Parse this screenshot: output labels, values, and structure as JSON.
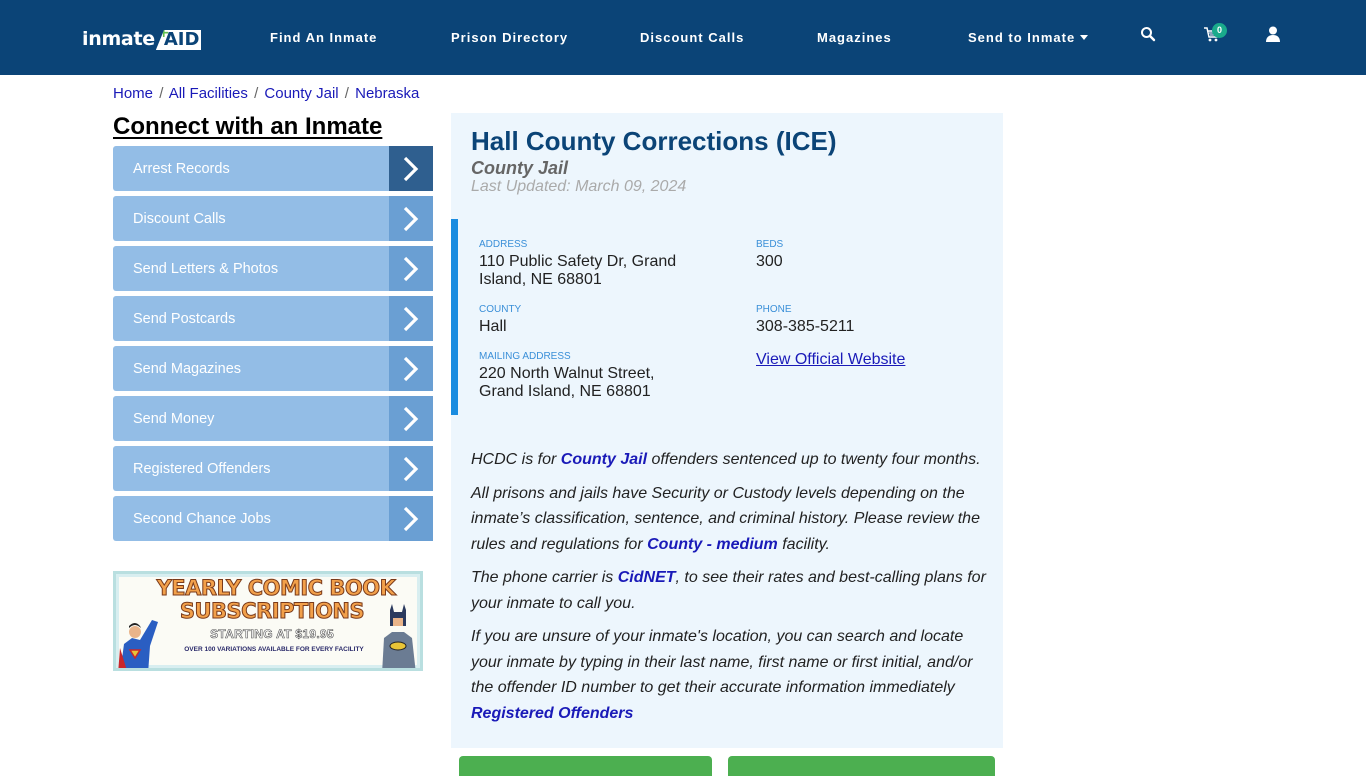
{
  "header": {
    "logo": {
      "part1": "inmate",
      "part2": "AID",
      "plus": "+"
    },
    "nav": [
      {
        "label": "Find An Inmate"
      },
      {
        "label": "Prison Directory"
      },
      {
        "label": "Discount Calls"
      },
      {
        "label": "Magazines"
      },
      {
        "label": "Send to Inmate",
        "dropdown": true
      }
    ],
    "icons": {
      "search": "search-icon",
      "cart": "cart-icon",
      "user": "user-icon"
    },
    "cart_count": "0"
  },
  "breadcrumb": [
    {
      "label": "Home"
    },
    {
      "label": "All Facilities"
    },
    {
      "label": "County Jail"
    },
    {
      "label": "Nebraska"
    }
  ],
  "breadcrumb_separator": "/",
  "sidebar": {
    "title": "Connect with an Inmate",
    "items": [
      {
        "label": "Arrest Records"
      },
      {
        "label": "Discount Calls"
      },
      {
        "label": "Send Letters & Photos"
      },
      {
        "label": "Send Postcards"
      },
      {
        "label": "Send Magazines"
      },
      {
        "label": "Send Money"
      },
      {
        "label": "Registered Offenders"
      },
      {
        "label": "Second Chance Jobs"
      }
    ],
    "banner": {
      "line1": "YEARLY COMIC BOOK",
      "line2": "SUBSCRIPTIONS",
      "line3": "STARTING AT $19.95",
      "line4": "OVER 100 VARIATIONS AVAILABLE FOR EVERY FACILITY"
    }
  },
  "facility": {
    "name": "Hall County Corrections (ICE)",
    "type": "County Jail",
    "last_updated": "Last Updated: March 09, 2024",
    "fields": {
      "address": {
        "label": "ADDRESS",
        "value": "110 Public Safety Dr, Grand Island, NE 68801"
      },
      "beds": {
        "label": "BEDS",
        "value": "300"
      },
      "county": {
        "label": "COUNTY",
        "value": "Hall"
      },
      "phone": {
        "label": "PHONE",
        "value": "308-385-5211"
      },
      "mailing": {
        "label": "MAILING ADDRESS",
        "value": "220 North Walnut Street, Grand Island, NE 68801"
      },
      "website_link": "View Official Website"
    },
    "description": {
      "p1": {
        "before": "HCDC is for ",
        "link": "County Jail",
        "after": " offenders sentenced up to twenty four months."
      },
      "p2": {
        "before": "All prisons and jails have Security or Custody levels depending on the inmate’s classification, sentence, and criminal history. Please review the rules and regulations for ",
        "link": "County - medium",
        "after": " facility."
      },
      "p3": {
        "before": "The phone carrier is ",
        "link": "CidNET",
        "after": ", to see their rates and best-calling plans for your inmate to call you."
      },
      "p4": {
        "before": "If you are unsure of your inmate's location, you can search and locate your inmate by typing in their last name, first name or first initial, and/or the offender ID number to get their accurate information immediately ",
        "link": "Registered Offenders",
        "after": ""
      }
    }
  },
  "colors": {
    "header_bg": "#0b4477",
    "sidebar_item": "#93bde6",
    "sidebar_arrow": "#6a9fd3",
    "sidebar_arrow_active": "#2f5f8f",
    "card_bg": "#edf6fd",
    "accent_bar": "#1a8ce0",
    "link": "#1a1ab8",
    "green_button": "#4caf50",
    "badge": "#1aaa8b"
  }
}
